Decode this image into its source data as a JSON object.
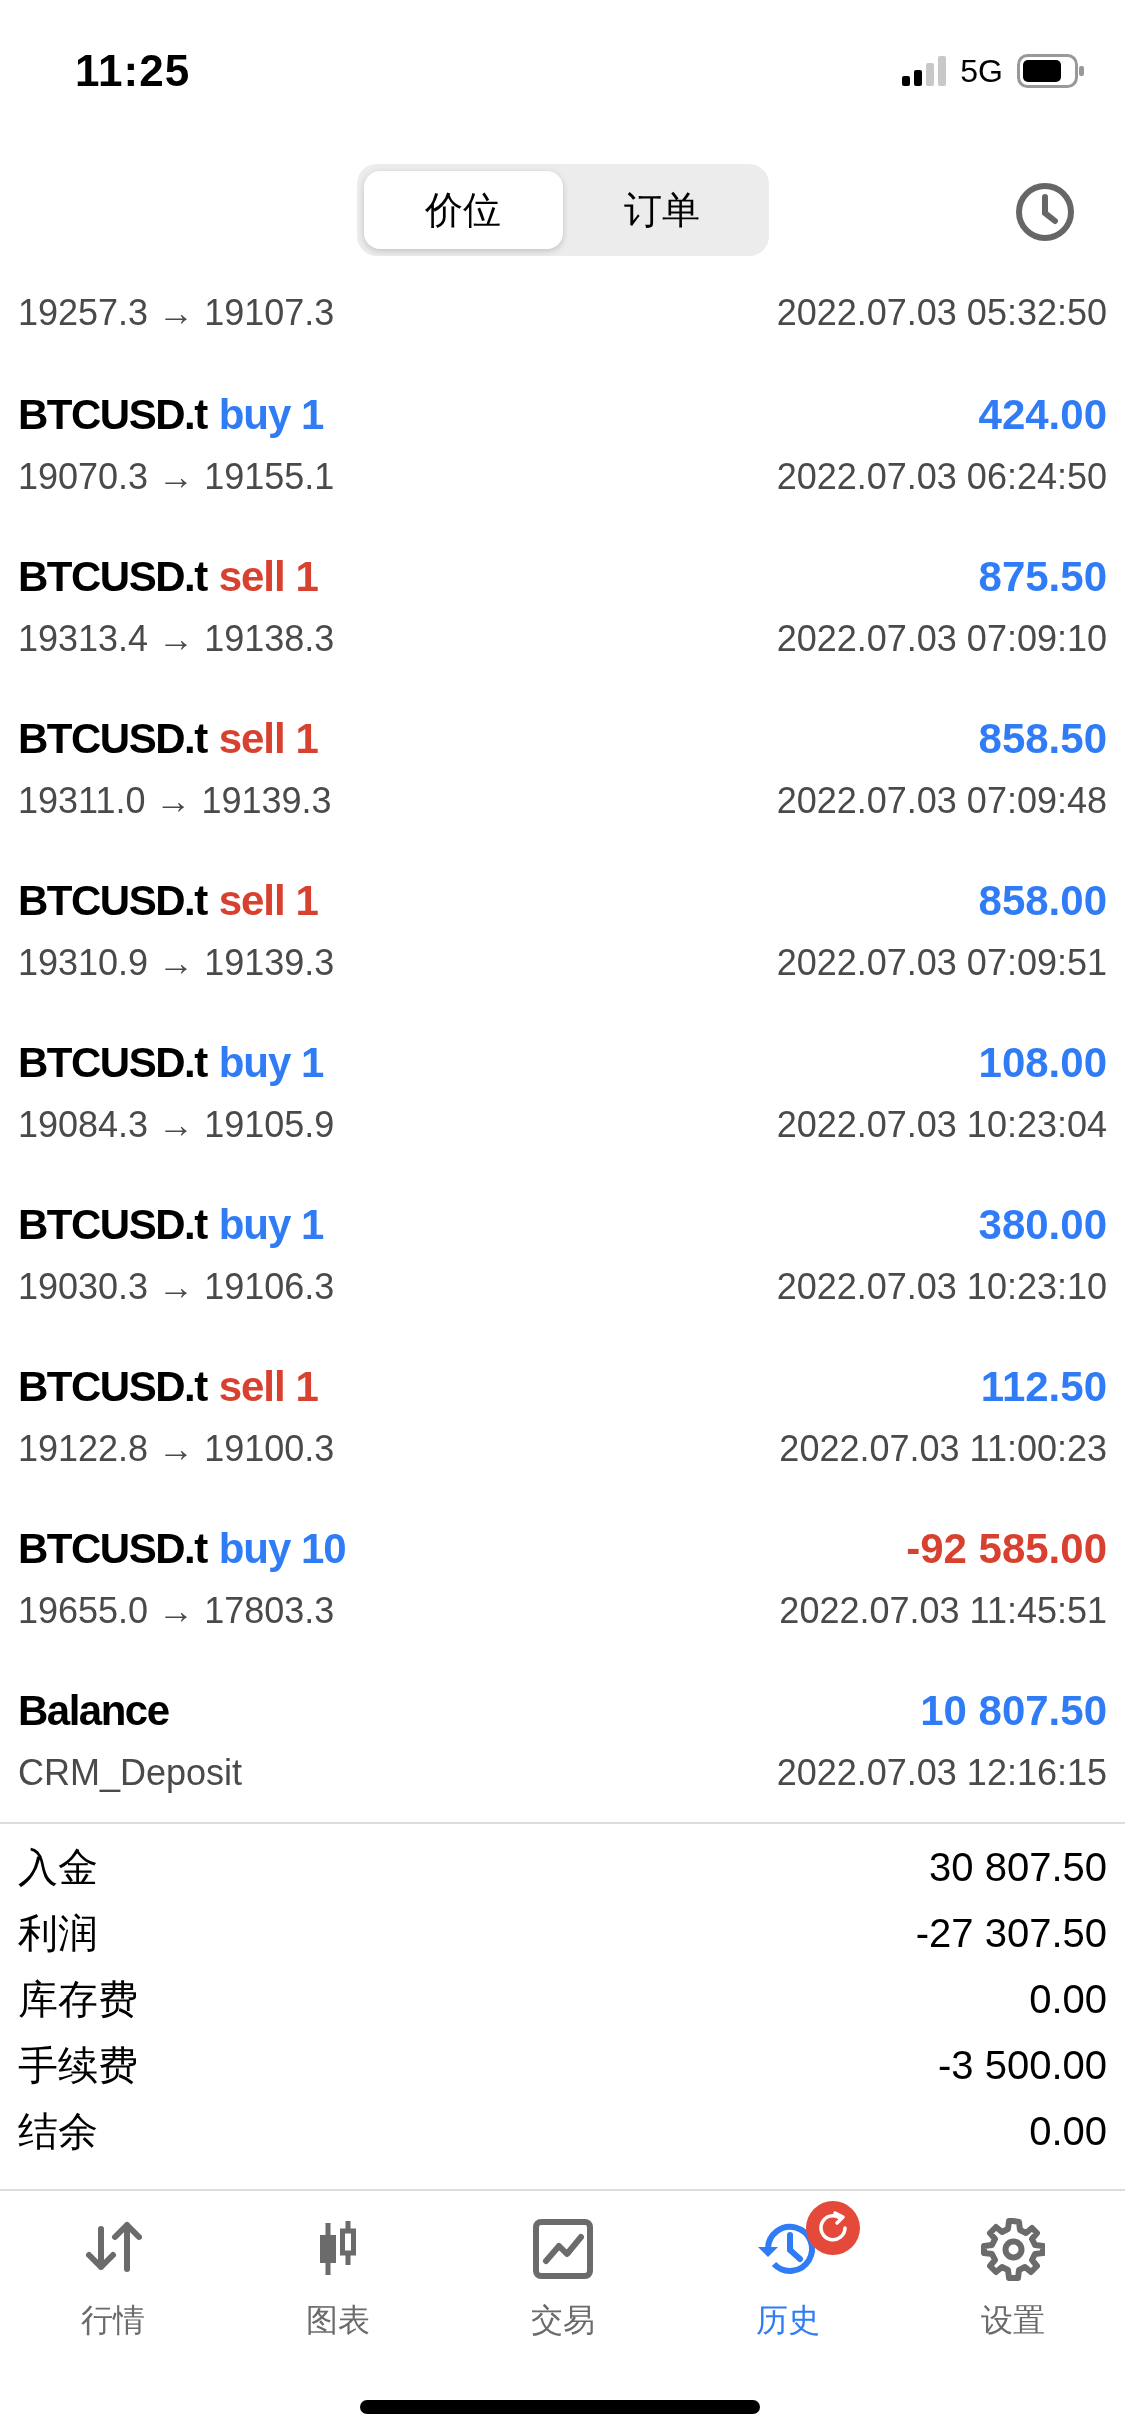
{
  "status_bar": {
    "time": "11:25",
    "network": "5G"
  },
  "segments": [
    {
      "label": "价位",
      "selected": true
    },
    {
      "label": "订单",
      "selected": false
    }
  ],
  "deals": [
    {
      "detail": "19257.3 → 19107.3",
      "time": "2022.07.03 05:32:50"
    },
    {
      "title": "BTCUSD.t",
      "side": {
        "text": "buy 1",
        "color": "#2f7cf6"
      },
      "amount": {
        "text": "424.00",
        "loss": false
      },
      "detail": "19070.3 → 19155.1",
      "time": "2022.07.03 06:24:50"
    },
    {
      "title": "BTCUSD.t",
      "side": {
        "text": "sell 1",
        "color": "#d8412f"
      },
      "amount": {
        "text": "875.50",
        "loss": false
      },
      "detail": "19313.4 → 19138.3",
      "time": "2022.07.03 07:09:10"
    },
    {
      "title": "BTCUSD.t",
      "side": {
        "text": "sell 1",
        "color": "#d8412f"
      },
      "amount": {
        "text": "858.50",
        "loss": false
      },
      "detail": "19311.0 → 19139.3",
      "time": "2022.07.03 07:09:48"
    },
    {
      "title": "BTCUSD.t",
      "side": {
        "text": "sell 1",
        "color": "#d8412f"
      },
      "amount": {
        "text": "858.00",
        "loss": false
      },
      "detail": "19310.9 → 19139.3",
      "time": "2022.07.03 07:09:51"
    },
    {
      "title": "BTCUSD.t",
      "side": {
        "text": "buy 1",
        "color": "#2f7cf6"
      },
      "amount": {
        "text": "108.00",
        "loss": false
      },
      "detail": "19084.3 → 19105.9",
      "time": "2022.07.03 10:23:04"
    },
    {
      "title": "BTCUSD.t",
      "side": {
        "text": "buy 1",
        "color": "#2f7cf6"
      },
      "amount": {
        "text": "380.00",
        "loss": false
      },
      "detail": "19030.3 → 19106.3",
      "time": "2022.07.03 10:23:10"
    },
    {
      "title": "BTCUSD.t",
      "side": {
        "text": "sell 1",
        "color": "#d8412f"
      },
      "amount": {
        "text": "112.50",
        "loss": false
      },
      "detail": "19122.8 → 19100.3",
      "time": "2022.07.03 11:00:23"
    },
    {
      "title": "BTCUSD.t",
      "side": {
        "text": "buy 10",
        "color": "#2f7cf6"
      },
      "amount": {
        "text": "-92 585.00",
        "loss": true
      },
      "detail": "19655.0 → 17803.3",
      "time": "2022.07.03 11:45:51"
    },
    {
      "title": "Balance",
      "amount": {
        "text": "10 807.50",
        "loss": false
      },
      "detail": "CRM_Deposit",
      "time": "2022.07.03 12:16:15"
    }
  ],
  "summary": [
    {
      "label": "入金",
      "value": "30 807.50"
    },
    {
      "label": "利润",
      "value": "-27 307.50"
    },
    {
      "label": "库存费",
      "value": "0.00"
    },
    {
      "label": "手续费",
      "value": "-3 500.00"
    },
    {
      "label": "结余",
      "value": "0.00"
    }
  ],
  "tab_bar": [
    {
      "label": "行情",
      "kind": "arrows",
      "selected": false
    },
    {
      "label": "图表",
      "kind": "candles",
      "selected": false
    },
    {
      "label": "交易",
      "kind": "chart",
      "selected": false
    },
    {
      "label": "历史",
      "kind": "history",
      "selected": true,
      "badge": true
    },
    {
      "label": "设置",
      "kind": "gear",
      "selected": false
    }
  ]
}
